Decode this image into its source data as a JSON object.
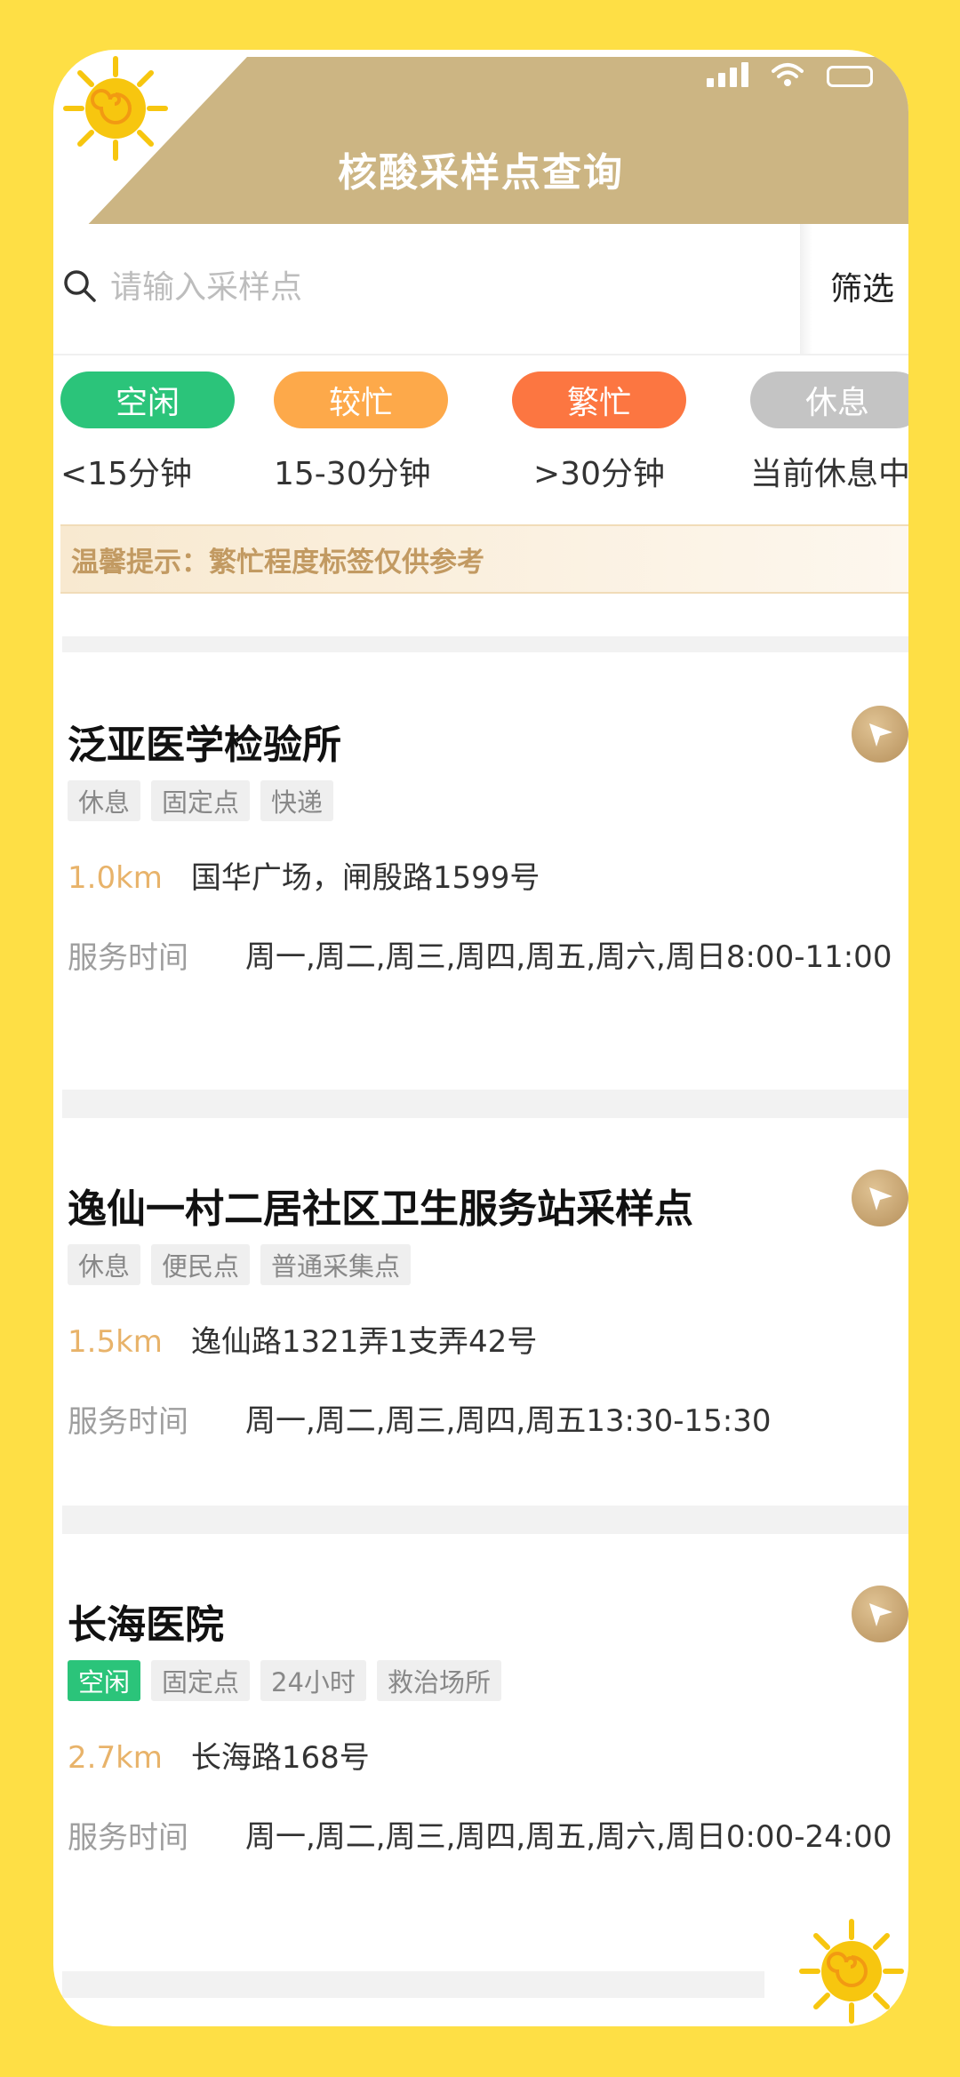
{
  "app": {
    "title": "核酸采样点查询"
  },
  "search": {
    "placeholder": "请输入采样点",
    "value": "",
    "filter_label": "筛选"
  },
  "legend": [
    {
      "label": "空闲",
      "desc": "<15分钟",
      "color": "#2BC47A"
    },
    {
      "label": "较忙",
      "desc": "15-30分钟",
      "color": "#FDA94A"
    },
    {
      "label": "繁忙",
      "desc": ">30分钟",
      "color": "#FC7641"
    },
    {
      "label": "休息",
      "desc": "当前休息中",
      "color": "#C4C4C4"
    }
  ],
  "tip": "温馨提示：繁忙程度标签仅供参考",
  "sites": [
    {
      "name": "泛亚医学检验所",
      "tags": [
        "休息",
        "固定点",
        "快递"
      ],
      "distance": "1.0km",
      "address": "国华广场，闸殷路1599号",
      "service_label": "服务时间",
      "service_time": "周一,周二,周三,周四,周五,周六,周日8:00-11:00"
    },
    {
      "name": "逸仙一村二居社区卫生服务站采样点",
      "tags": [
        "休息",
        "便民点",
        "普通采集点"
      ],
      "distance": "1.5km",
      "address": "逸仙路1321弄1支弄42号",
      "service_label": "服务时间",
      "service_time": "周一,周二,周三,周四,周五13:30-15:30"
    },
    {
      "name": "长海医院",
      "tags": [
        "空闲",
        "固定点",
        "24小时",
        "救治场所"
      ],
      "distance": "2.7km",
      "address": "长海路168号",
      "service_label": "服务时间",
      "service_time": "周一,周二,周三,周四,周五,周六,周日0:00-24:00"
    }
  ],
  "colors": {
    "frame": "#FEDF45",
    "header": "#CCB583",
    "accent": "#E8B36A",
    "idle": "#2BC47A"
  }
}
